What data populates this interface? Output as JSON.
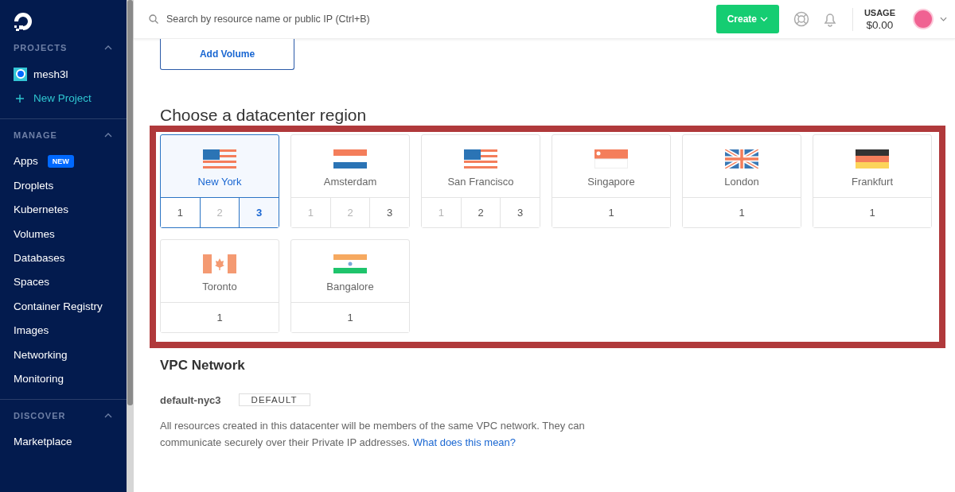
{
  "sidebar": {
    "sections": [
      {
        "title": "PROJECTS",
        "items": [
          {
            "label": "mesh3l",
            "kind": "project"
          },
          {
            "label": "New Project",
            "kind": "add"
          }
        ]
      },
      {
        "title": "MANAGE",
        "items": [
          {
            "label": "Apps",
            "kind": "link",
            "badge": "NEW"
          },
          {
            "label": "Droplets",
            "kind": "link"
          },
          {
            "label": "Kubernetes",
            "kind": "link"
          },
          {
            "label": "Volumes",
            "kind": "link"
          },
          {
            "label": "Databases",
            "kind": "link"
          },
          {
            "label": "Spaces",
            "kind": "link"
          },
          {
            "label": "Container Registry",
            "kind": "link"
          },
          {
            "label": "Images",
            "kind": "link"
          },
          {
            "label": "Networking",
            "kind": "link"
          },
          {
            "label": "Monitoring",
            "kind": "link"
          }
        ]
      },
      {
        "title": "DISCOVER",
        "items": [
          {
            "label": "Marketplace",
            "kind": "link"
          }
        ]
      }
    ]
  },
  "topbar": {
    "search": {
      "placeholder": "Search by resource name or public IP (Ctrl+B)"
    },
    "create_button": "Create",
    "usage": {
      "label": "USAGE",
      "value": "$0.00"
    }
  },
  "add_volume_button": "Add Volume",
  "datacenter": {
    "title": "Choose a datacenter region",
    "highlighted": true,
    "regions": [
      {
        "name": "New York",
        "kind": "us",
        "selected": true,
        "datacenters": [
          {
            "label": "1",
            "disabled": false,
            "selected": false
          },
          {
            "label": "2",
            "disabled": true,
            "selected": false
          },
          {
            "label": "3",
            "disabled": false,
            "selected": true
          }
        ]
      },
      {
        "name": "Amsterdam",
        "kind": "nl",
        "selected": false,
        "datacenters": [
          {
            "label": "1",
            "disabled": true,
            "selected": false
          },
          {
            "label": "2",
            "disabled": true,
            "selected": false
          },
          {
            "label": "3",
            "disabled": false,
            "selected": false
          }
        ]
      },
      {
        "name": "San Francisco",
        "kind": "us",
        "selected": false,
        "datacenters": [
          {
            "label": "1",
            "disabled": true,
            "selected": false
          },
          {
            "label": "2",
            "disabled": false,
            "selected": false
          },
          {
            "label": "3",
            "disabled": false,
            "selected": false
          }
        ]
      },
      {
        "name": "Singapore",
        "kind": "sg",
        "selected": false,
        "datacenters": [
          {
            "label": "1",
            "disabled": false,
            "selected": false
          }
        ]
      },
      {
        "name": "London",
        "kind": "gb",
        "selected": false,
        "datacenters": [
          {
            "label": "1",
            "disabled": false,
            "selected": false
          }
        ]
      },
      {
        "name": "Frankfurt",
        "kind": "de",
        "selected": false,
        "datacenters": [
          {
            "label": "1",
            "disabled": false,
            "selected": false
          }
        ]
      },
      {
        "name": "Toronto",
        "kind": "ca",
        "selected": false,
        "datacenters": [
          {
            "label": "1",
            "disabled": false,
            "selected": false
          }
        ]
      },
      {
        "name": "Bangalore",
        "kind": "in",
        "selected": false,
        "datacenters": [
          {
            "label": "1",
            "disabled": false,
            "selected": false
          }
        ]
      }
    ]
  },
  "vpc": {
    "title": "VPC Network",
    "name": "default-nyc3",
    "tag": "DEFAULT",
    "description": "All resources created in this datacenter will be members of the same VPC network. They can communicate securely over their Private IP addresses.",
    "link": "What does this mean?"
  }
}
